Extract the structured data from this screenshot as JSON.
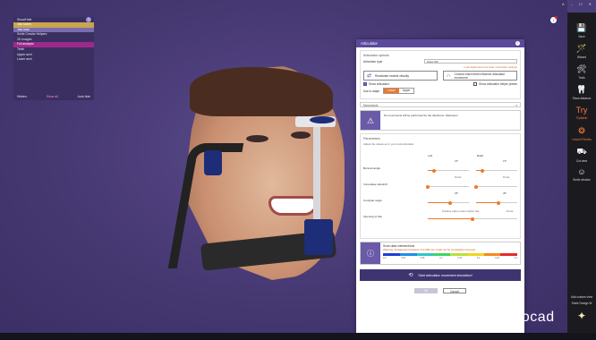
{
  "window": {
    "controls": "A  –  ☐  ✕"
  },
  "tree": {
    "title": "Show/Hide",
    "items": [
      {
        "label": "Jaw scans"
      },
      {
        "label": "Jaw scan"
      },
      {
        "label": "Smile Creator Helpers"
      },
      {
        "label": "2D Images"
      },
      {
        "label": "Full analysis"
      },
      {
        "label": "Teeth"
      },
      {
        "label": "Upper arch"
      },
      {
        "label": "Lower arch"
      }
    ],
    "footer": {
      "hidden": "Hidden",
      "show_all": "Show all",
      "auto_hide": "Auto hide"
    }
  },
  "articulator": {
    "title": "Articulator",
    "options_header": "Articulator options",
    "type_label": "Articulator type",
    "type_value": "Artex CR",
    "type_link": "Load digital face bow data / articulator settings",
    "reactivate_btn": "Reactivate models virtually",
    "choose_btn": "Choose which teeth influence articulator movement",
    "show_articulator": "Show articulator",
    "show_helper": "Show articulator helper planes",
    "use_to_adapt": "Use to adapt",
    "seg_lower": "Lower",
    "seg_upper": "Upper",
    "movements": "Movements",
    "warning": "No movements will be performed for the directions: •Retrusion",
    "params_header": "Parameters",
    "params_sub": "Adjust the values as in your real articulator",
    "left": "Left",
    "right": "Right",
    "rows": [
      {
        "label": "Bennett angle",
        "left_val": "15°",
        "right_val": "15°",
        "left_pos": 0.15,
        "right_pos": 0.15
      },
      {
        "label": "Immediate sideshift",
        "left_val": "0 mm",
        "right_val": "0 mm",
        "left_pos": 0.0,
        "right_pos": 0.0
      },
      {
        "label": "Condylar angle",
        "left_val": "35°",
        "right_val": "35°",
        "left_pos": 0.55,
        "right_pos": 0.55
      }
    ],
    "opening_label": "Opening of bite",
    "opening_sub": "Positive value means higher bite",
    "opening_val": "0 mm",
    "opening_pos": 0.5,
    "scan_header": "Scan data intersections",
    "scan_warning": "Warning: Antagonist intrusions of 0,000 mm could not be completely removed.",
    "legend_ticks": [
      "0.0",
      "0.05",
      "0.08",
      "0.1",
      "0.15",
      "0.2",
      "0.25",
      "0.3"
    ],
    "legend_colors": [
      "#1a3fd6",
      "#1f8ee6",
      "#2fc6c6",
      "#3fd46a",
      "#b8e23a",
      "#f2d322",
      "#f28a1e",
      "#e52a2a"
    ],
    "start_btn": "Start articulator movement simulation!",
    "ok": "Ok",
    "cancel": "Cancel"
  },
  "right_bar": [
    {
      "icon": "💾",
      "label": "Save"
    },
    {
      "icon": "🪄",
      "label": "Wizard"
    },
    {
      "icon": "🛠",
      "label": "Tools"
    },
    {
      "icon": "🦷",
      "label": "Show distance"
    },
    {
      "icon": "Try",
      "label": "Tryilstein",
      "orange": true
    },
    {
      "icon": "❂",
      "label": "Linked Preview",
      "orange": true
    },
    {
      "icon": "⛟",
      "label": "Cut view"
    },
    {
      "icon": "☺",
      "label": "Smile window"
    }
  ],
  "right_bar_bottom": {
    "add_custom": "Add custom view",
    "smile_design": "Smile Design W"
  },
  "notification": "1",
  "logo": "exocad"
}
